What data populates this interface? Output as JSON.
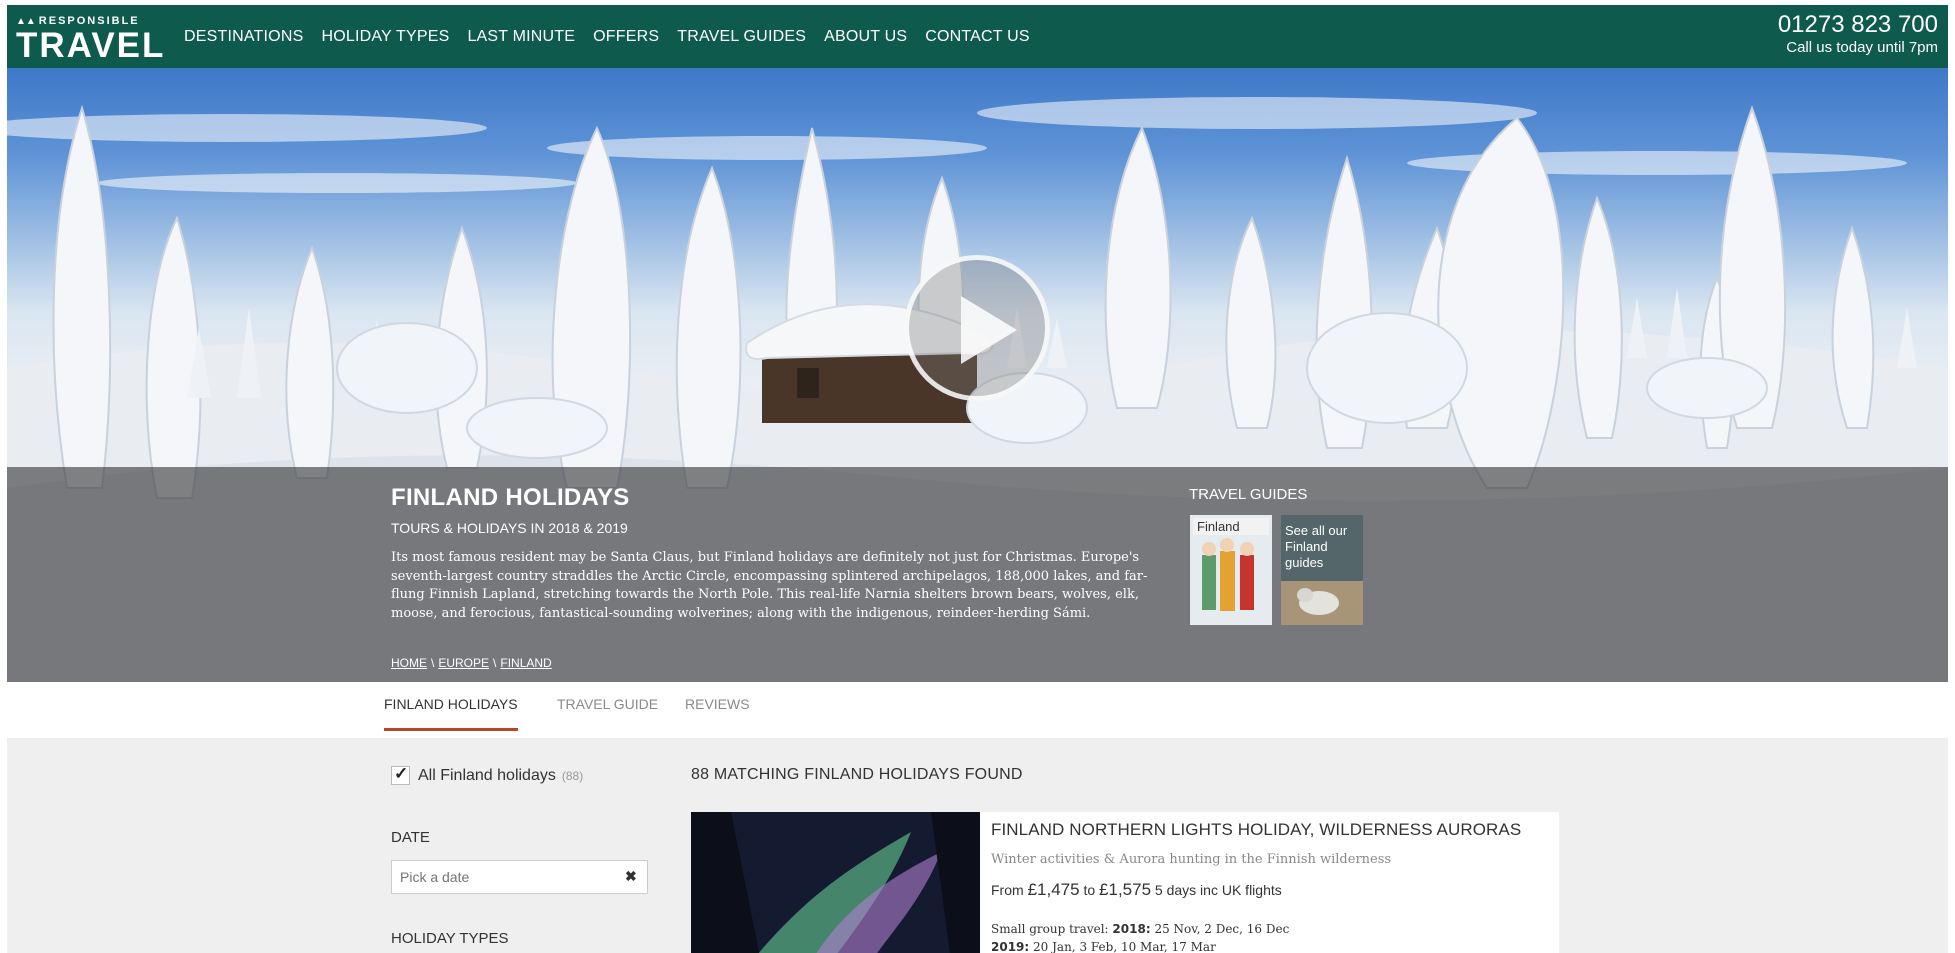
{
  "header": {
    "logo_small": "RESPONSIBLE",
    "logo_big": "TRAVEL",
    "nav": [
      "DESTINATIONS",
      "HOLIDAY TYPES",
      "LAST MINUTE",
      "OFFERS",
      "TRAVEL GUIDES",
      "ABOUT US",
      "CONTACT US"
    ],
    "phone": "01273 823 700",
    "phone_sub": "Call us today until 7pm"
  },
  "hero": {
    "title": "FINLAND HOLIDAYS",
    "subtitle": "TOURS & HOLIDAYS IN 2018 & 2019",
    "description": "Its most famous resident may be Santa Claus, but Finland holidays are definitely not just for Christmas. Europe's seventh-largest country straddles the Arctic Circle, encompassing splintered archipelagos, 188,000 lakes, and far-flung Finnish Lapland, stretching towards the North Pole. This real-life Narnia shelters brown bears, wolves, elk, moose, and ferocious, fantastical-sounding wolverines; along with the indigenous, reindeer-herding Sámi.",
    "breadcrumb": [
      "HOME",
      "EUROPE",
      "FINLAND"
    ],
    "breadcrumb_sep": "\\",
    "guides_title": "TRAVEL GUIDES",
    "guide_card_label": "Finland",
    "guide_more": "See all our Finland guides"
  },
  "tabs": [
    "FINLAND HOLIDAYS",
    "TRAVEL GUIDE",
    "REVIEWS"
  ],
  "filters": {
    "all_label": "All Finland holidays",
    "all_count": "(88)",
    "all_checked": true,
    "date_label": "DATE",
    "date_placeholder": "Pick a date",
    "types_label": "HOLIDAY TYPES"
  },
  "results": {
    "count_text": "88 MATCHING FINLAND HOLIDAYS FOUND",
    "items": [
      {
        "title": "FINLAND NORTHERN LIGHTS HOLIDAY, WILDERNESS AURORAS",
        "subtitle": "Winter activities & Aurora hunting in the Finnish wilderness",
        "price_from": "From",
        "price_low": "£1,475",
        "price_to": "to",
        "price_high": "£1,575",
        "duration": "5 days inc UK flights",
        "dates_prefix": "Small group travel:",
        "year1": "2018:",
        "dates1": "25 Nov, 2 Dec, 16 Dec",
        "year2": "2019:",
        "dates2": "20 Jan, 3 Feb, 10 Mar, 17 Mar"
      }
    ]
  },
  "colors": {
    "header_bg": "#0e5a4d",
    "tab_accent": "#b7462a",
    "content_bg": "#efefef"
  }
}
